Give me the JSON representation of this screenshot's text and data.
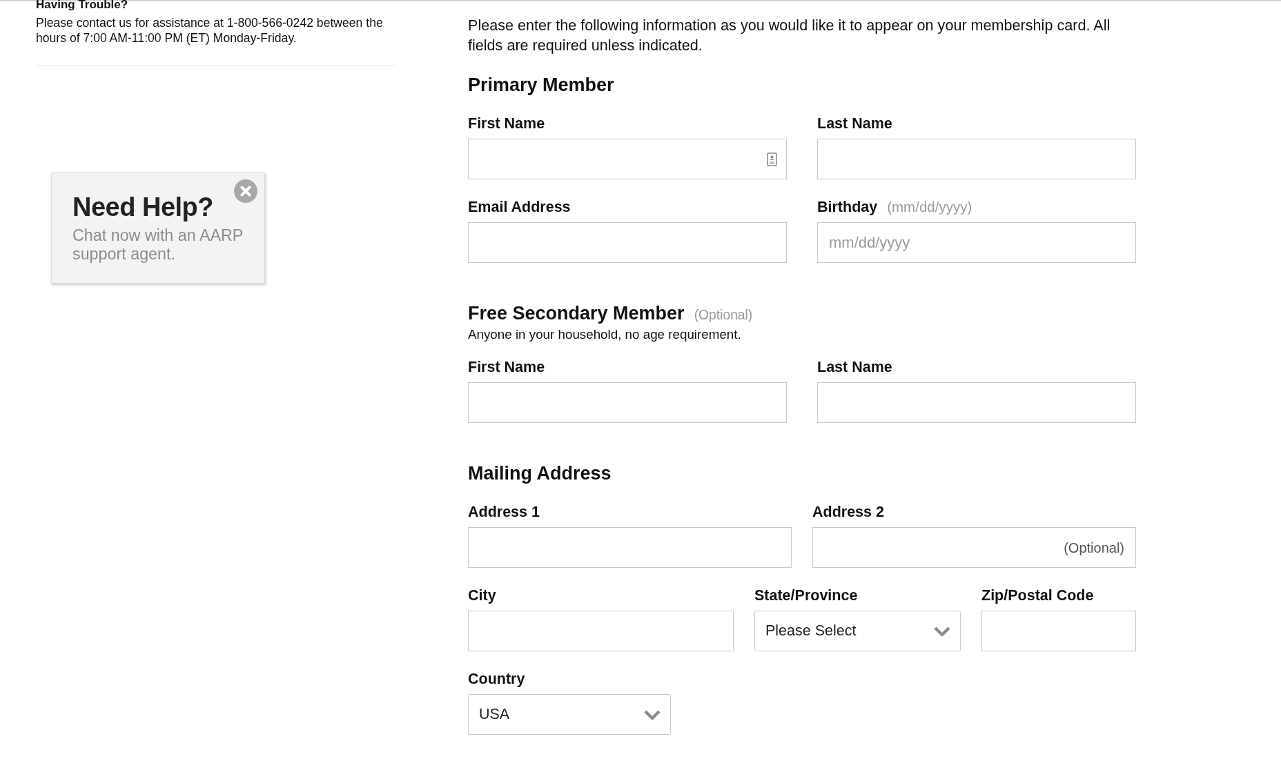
{
  "help": {
    "title": "Having Trouble?",
    "text": "Please contact us for assistance at 1-800-566-0242 between the hours of 7:00 AM-11:00 PM (ET) Monday-Friday."
  },
  "chat_popup": {
    "title": "Need Help?",
    "text": "Chat now with an AARP support agent."
  },
  "form": {
    "intro": "Please enter the following information as you would like it to appear on your membership card. All fields are required unless indicated.",
    "sections": [
      {
        "title": "Primary Member",
        "rows": [
          [
            {
              "label": "First Name",
              "kind": "text",
              "autofill": true
            },
            {
              "label": "Last Name",
              "kind": "text",
              "autofill": false
            }
          ],
          [
            {
              "label": "Email Address",
              "kind": "text",
              "autofill": false
            },
            {
              "label": "Birthday",
              "label_note": "(mm/dd/yyyy)",
              "kind": "date",
              "placeholder": "mm/dd/yyyy",
              "autofill": false
            }
          ]
        ]
      },
      {
        "title": "Free Secondary Member",
        "title_note": "(Optional)",
        "subtitle": "Anyone in your household, no age requirement.",
        "rows": [
          [
            {
              "label": "First Name",
              "kind": "text",
              "autofill": false
            },
            {
              "label": "Last Name",
              "kind": "text",
              "autofill": false
            }
          ]
        ]
      },
      {
        "title": "Mailing Address",
        "rows": [
          [
            {
              "label": "Address 1",
              "kind": "text",
              "autofill": false
            },
            {
              "label": "Address 2",
              "kind": "text",
              "placeholder": "(Optional)",
              "autofill": false
            }
          ],
          [
            {
              "label": "City",
              "kind": "text",
              "autofill": false
            },
            {
              "label": "State/Province",
              "kind": "select",
              "value": "Please Select"
            },
            {
              "label": "Zip/Postal Code",
              "kind": "text",
              "autofill": false
            }
          ],
          [
            {
              "label": "Country",
              "kind": "select",
              "value": "USA"
            }
          ]
        ]
      }
    ]
  }
}
